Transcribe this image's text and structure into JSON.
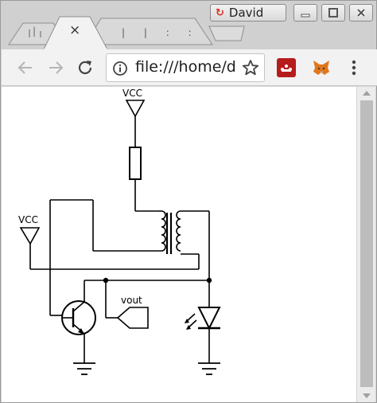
{
  "window": {
    "user_name": "David",
    "tabs": [
      {
        "label": "|",
        "active": false
      },
      {
        "label": "",
        "active": true,
        "close_glyph": "×"
      },
      {
        "label": "| | : :",
        "active": false
      },
      {
        "label": "",
        "active": false,
        "new_tab": true
      }
    ],
    "controls": [
      "minimize-icon",
      "maximize-icon",
      "close-icon"
    ]
  },
  "toolbar": {
    "back_icon": "arrow-left-icon",
    "forward_icon": "arrow-right-icon",
    "reload_icon": "reload-icon",
    "url": "file:///home/d",
    "page_info_icon": "info-icon",
    "bookmark_icon": "star-icon",
    "extensions": [
      "mendeley-icon",
      "metamask-fox-icon"
    ],
    "menu_icon": "three-dots-vertical-icon"
  },
  "schematic": {
    "labels": {
      "vcc_top": "VCC",
      "vcc_left": "VCC",
      "vout": "vout"
    },
    "components": [
      "resistor",
      "transformer",
      "npn-transistor",
      "led",
      "ground",
      "ground",
      "output-port"
    ]
  },
  "colors": {
    "frame": "#d0d0d0",
    "toolbar": "#f2f2f2",
    "extension_red": "#b71c1c",
    "sync_red": "#d93025"
  }
}
